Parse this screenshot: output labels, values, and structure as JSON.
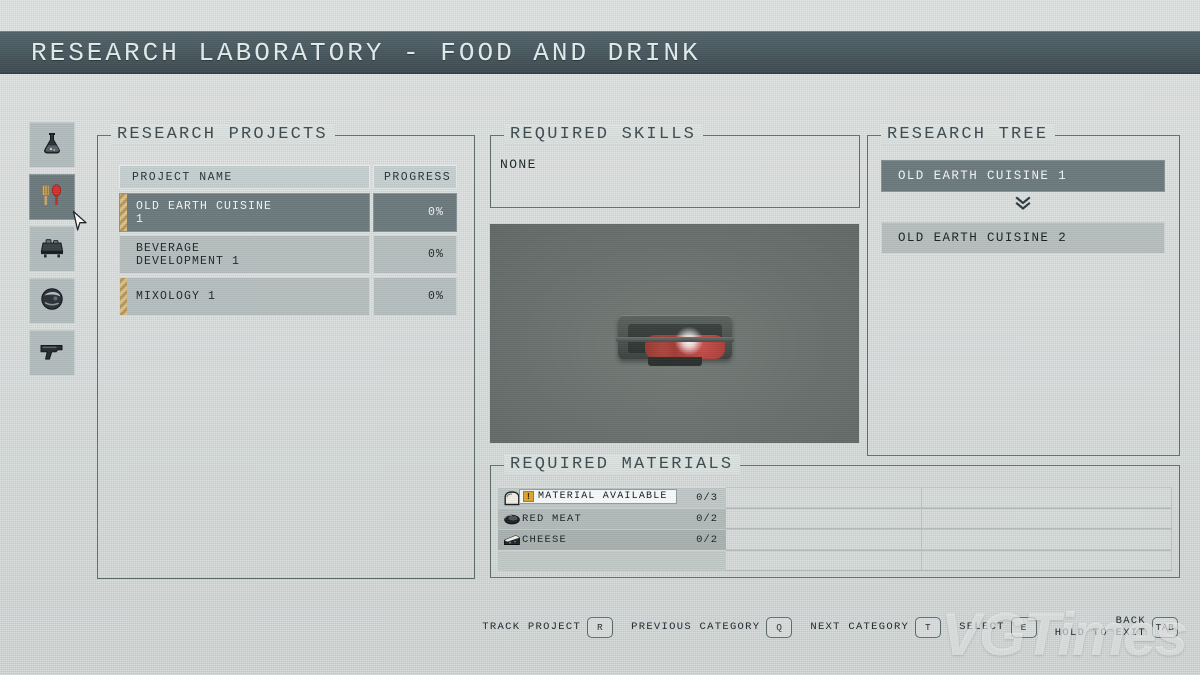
{
  "header": {
    "title": "RESEARCH LABORATORY - FOOD AND DRINK"
  },
  "sidebar": {
    "items": [
      {
        "name": "pharmacology",
        "icon": "flask-icon",
        "selected": false
      },
      {
        "name": "food-and-drink",
        "icon": "utensils-icon",
        "selected": true
      },
      {
        "name": "manufacturing",
        "icon": "workbench-icon",
        "selected": false
      },
      {
        "name": "equipment",
        "icon": "helmet-icon",
        "selected": false
      },
      {
        "name": "weaponry",
        "icon": "pistol-icon",
        "selected": false
      }
    ]
  },
  "projects": {
    "panel_title": "RESEARCH PROJECTS",
    "columns": {
      "name": "PROJECT NAME",
      "progress": "PROGRESS"
    },
    "rows": [
      {
        "name": "OLD EARTH CUISINE\n1",
        "progress": "0%",
        "selected": true,
        "tracked": true
      },
      {
        "name": "BEVERAGE\nDEVELOPMENT 1",
        "progress": "0%",
        "selected": false,
        "tracked": false
      },
      {
        "name": "MIXOLOGY 1",
        "progress": "0%",
        "selected": false,
        "tracked": true
      }
    ]
  },
  "skills": {
    "panel_title": "REQUIRED SKILLS",
    "value": "NONE"
  },
  "materials": {
    "panel_title": "REQUIRED MATERIALS",
    "tooltip": {
      "text": "MATERIAL AVAILABLE",
      "icon": "warning-icon"
    },
    "rows": [
      {
        "icon": "bread-icon",
        "name": "",
        "count": "0/3"
      },
      {
        "icon": "red-meat-icon",
        "name": "RED MEAT",
        "count": "0/2"
      },
      {
        "icon": "cheese-icon",
        "name": "CHEESE",
        "count": "0/2"
      }
    ]
  },
  "tree": {
    "panel_title": "RESEARCH TREE",
    "nodes": [
      {
        "label": "OLD EARTH CUISINE 1",
        "selected": true
      },
      {
        "label": "OLD EARTH CUISINE 2",
        "selected": false
      }
    ],
    "arrow": "»"
  },
  "controls": [
    {
      "label": "TRACK PROJECT",
      "key": "R"
    },
    {
      "label": "PREVIOUS CATEGORY",
      "key": "Q"
    },
    {
      "label": "NEXT CATEGORY",
      "key": "T"
    },
    {
      "label": "SELECT",
      "key": "E"
    },
    {
      "label": "BACK\nHOLD TO EXIT",
      "key": "TAB"
    }
  ],
  "watermark": {
    "text": "VGTimes"
  },
  "colors": {
    "titlebar": "#4b5b62",
    "selected_row": "#6d7a7d",
    "row": "#b5bfbe",
    "panel_border": "#5c6d6c",
    "tracked_marker": "#d9c08a",
    "warning": "#e0a531"
  }
}
